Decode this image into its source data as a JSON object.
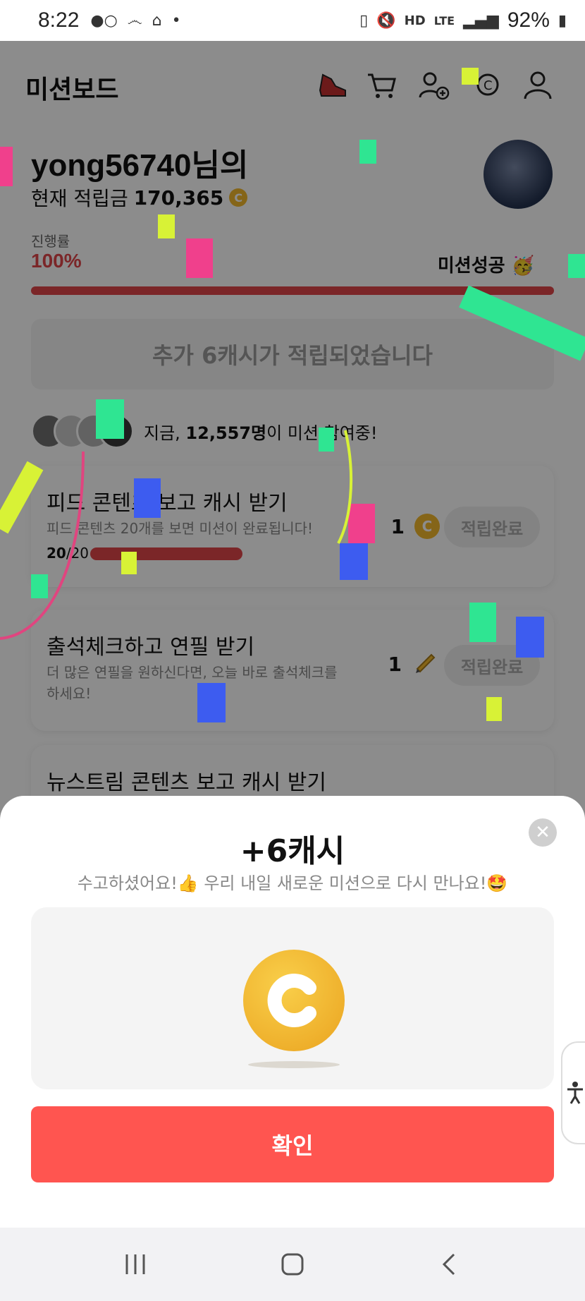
{
  "status": {
    "time": "8:22",
    "battery": "92%",
    "network": "LTE",
    "hd": "HD"
  },
  "header": {
    "title": "미션보드",
    "icons": [
      "shoe-icon",
      "cart-icon",
      "add-user-icon",
      "cash-icon",
      "profile-icon"
    ]
  },
  "user": {
    "name": "yong56740님의",
    "points_label": "현재 적립금",
    "points_value": "170,365"
  },
  "progress": {
    "label": "진행률",
    "value": "100%",
    "fraction": 1.0,
    "status": "미션성공 🥳"
  },
  "notice": "추가 6캐시가 적립되었습니다",
  "participants": {
    "prefix": "지금, ",
    "count": "12,557명",
    "suffix": "이 미션 참여중!"
  },
  "missions": [
    {
      "title": "피드 콘텐츠 보고 캐시 받기",
      "desc": "피드 콘텐츠 20개를 보면 미션이 완료됩니다!",
      "reward": "1",
      "reward_icon": "coin-icon",
      "button": "적립완료",
      "count_done": "20",
      "count_total": "/20",
      "progress_fraction": 1.0
    },
    {
      "title": "출석체크하고 연필 받기",
      "desc": "더 많은 연필을 원하신다면, 오늘 바로 출석체크를 하세요!",
      "reward": "1",
      "reward_icon": "pencil-icon",
      "button": "적립완료"
    },
    {
      "title": "뉴스트림 콘텐츠 보고 캐시 받기"
    }
  ],
  "sheet": {
    "title": "+6캐시",
    "subtitle": "수고하셨어요!👍 우리 내일 새로운 미션으로 다시 만나요!🤩",
    "confirm": "확인"
  },
  "colors": {
    "accent": "#e0454a",
    "confirm": "#ff5550",
    "coin": "#f2b92c"
  }
}
